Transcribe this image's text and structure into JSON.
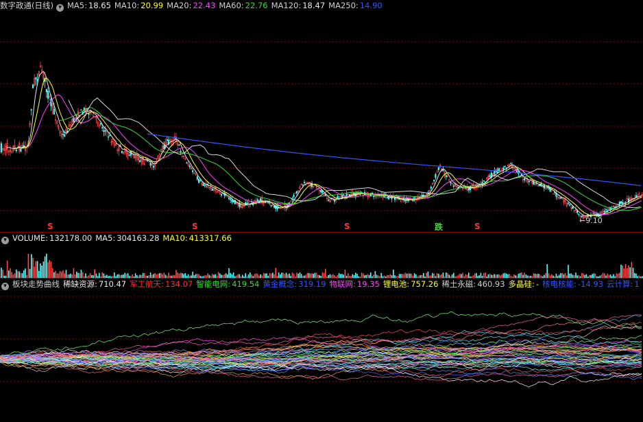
{
  "colors": {
    "background": "#000000",
    "grid": "#8b0000",
    "up": "#ff4d4d",
    "down": "#54ffff",
    "ma5": "#e8e8e8",
    "ma10": "#ffff33",
    "ma20": "#ff44ff",
    "ma60": "#33dd33",
    "ma120": "#d8d8d8",
    "ma250": "#3355ff",
    "label": "#d0d0d0",
    "value_white": "#e8e8e8",
    "value_yellow": "#ffff33",
    "value_magenta": "#ff44ff",
    "value_green": "#33dd33",
    "value_red": "#ff3030",
    "value_blue": "#3355ff"
  },
  "price_panel": {
    "title": "数字政通(日线)",
    "indicators": [
      {
        "label": "MA5:",
        "value": "18.65",
        "color": "#e8e8e8"
      },
      {
        "label": "MA10:",
        "value": "20.99",
        "color": "#ffff33"
      },
      {
        "label": "MA20:",
        "value": "22.43",
        "color": "#ff44ff"
      },
      {
        "label": "MA60:",
        "value": "22.76",
        "color": "#33dd33"
      },
      {
        "label": "MA120:",
        "value": "18.47",
        "color": "#e8e8e8"
      },
      {
        "label": "MA250:",
        "value": "14.90",
        "color": "#3355ff"
      }
    ],
    "low_label": "9.10",
    "event_markers": [
      "S",
      "S",
      "S",
      "跌",
      "S"
    ]
  },
  "volume_panel": {
    "indicators": [
      {
        "label": "VOLUME:",
        "value": "132178.00",
        "color": "#e8e8e8"
      },
      {
        "label": "MA5:",
        "value": "304163.28",
        "color": "#e8e8e8"
      },
      {
        "label": "MA10:",
        "value": "413317.66",
        "color": "#ffff33"
      }
    ]
  },
  "sector_panel": {
    "title": "板块走势曲线",
    "sectors": [
      {
        "label": "稀缺资源:",
        "value": "710.47",
        "color": "#e8e8e8"
      },
      {
        "label": "军工航天:",
        "value": "134.07",
        "color": "#ff3030"
      },
      {
        "label": "智能电网:",
        "value": "419.54",
        "color": "#33dd33"
      },
      {
        "label": "黄金概念:",
        "value": "319.19",
        "color": "#3355ff"
      },
      {
        "label": "物联网:",
        "value": "19.35",
        "color": "#ff44ff"
      },
      {
        "label": "锂电池:",
        "value": "757.26",
        "color": "#ffff33"
      },
      {
        "label": "稀土永磁:",
        "value": "460.93",
        "color": "#d0d0d0"
      },
      {
        "label": "多晶硅:",
        "value": "-",
        "color": "#ffff33"
      },
      {
        "label": "核电核能:",
        "value": "-14.93",
        "color": "#3355ff"
      },
      {
        "label": "云计算:",
        "value": "1",
        "color": "#3355ff"
      }
    ]
  }
}
